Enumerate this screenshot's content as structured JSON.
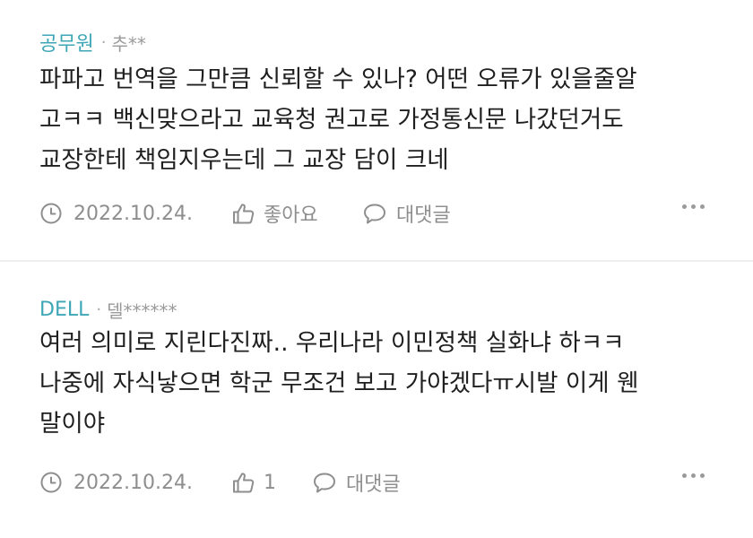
{
  "comments": [
    {
      "nickname": "공무원",
      "separator": "·",
      "masked_id": "추**",
      "lines": [
        "파파고 번역을 그만큼 신뢰할 수 있나? 어떤 오류가 있을줄알",
        "고ㅋㅋ 백신맞으라고 교육청 권고로 가정통신문 나갔던거도",
        "교장한테 책임지우는데 그 교장 담이 크네"
      ],
      "date": "2022.10.24.",
      "like_label": "좋아요",
      "reply_label": "대댓글"
    },
    {
      "nickname": "DELL",
      "separator": "·",
      "masked_id": "델******",
      "lines": [
        "여러 의미로 지린다진짜.. 우리나라 이민정책 실화냐 하ㅋㅋ",
        "나중에 자식낳으면 학군 무조건 보고 가야겠다ㅠ시발 이게 웬",
        "말이야"
      ],
      "date": "2022.10.24.",
      "like_label": "1",
      "reply_label": "대댓글"
    }
  ],
  "icons": {
    "clock": "clock-icon",
    "like": "thumbs-up-icon",
    "reply": "speech-bubble-icon",
    "more": "more-horizontal-icon"
  },
  "colors": {
    "nickname": "#3ea6b6",
    "meta_gray": "#8e8e8e",
    "divider": "#eeeeee",
    "text": "#1f1f1f"
  }
}
